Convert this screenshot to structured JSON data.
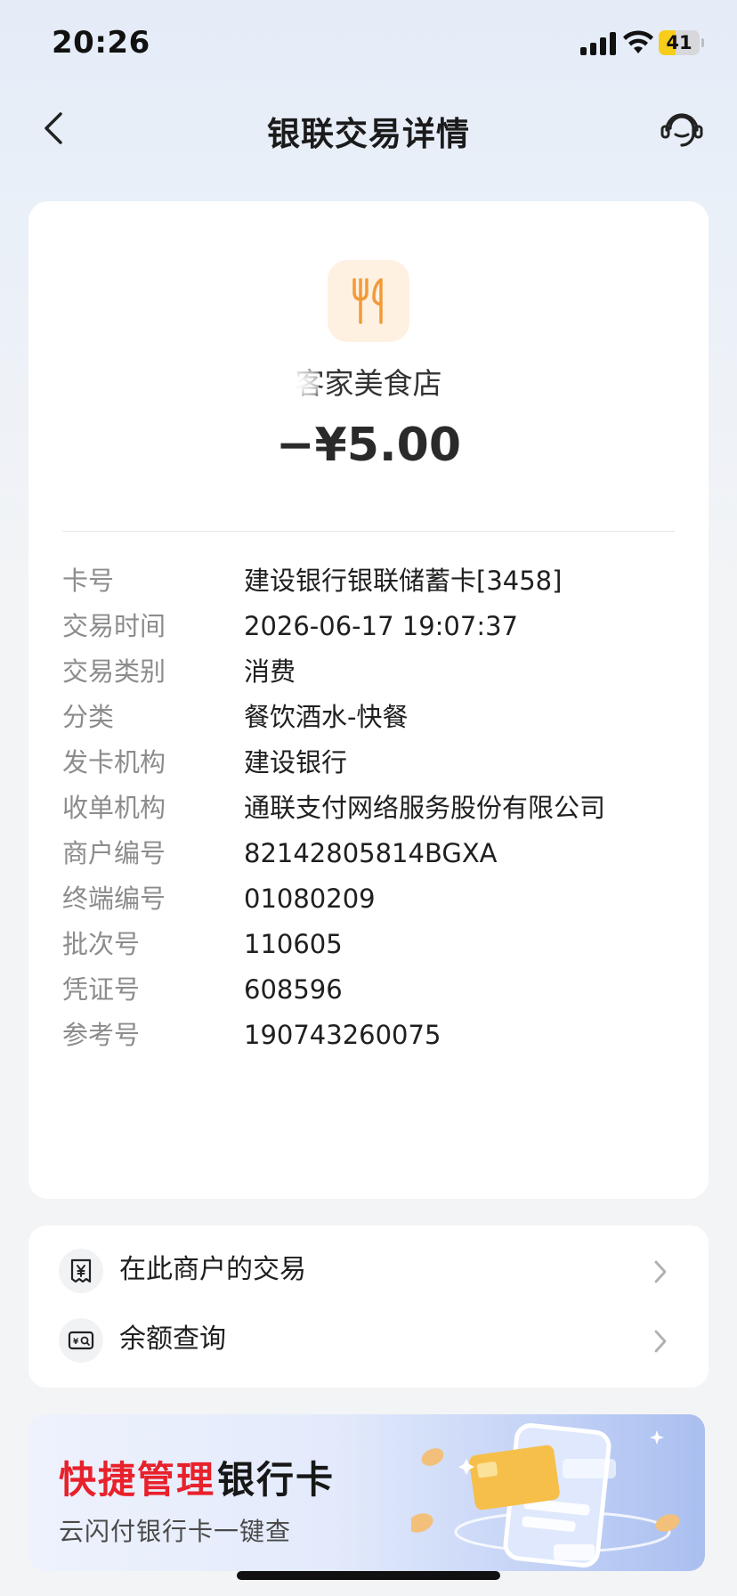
{
  "status_bar": {
    "time": "20:26",
    "battery": "41",
    "battery_level": 0.41
  },
  "nav": {
    "title": "银联交易详情",
    "back_icon": "chevron-left-icon",
    "service_icon": "headset-icon"
  },
  "transaction": {
    "merchant_icon": "fork-knife-icon",
    "merchant_name": "客家美食店",
    "amount": "−¥5.00",
    "details": [
      {
        "label": "卡号",
        "value": "建设银行银联储蓄卡[3458]"
      },
      {
        "label": "交易时间",
        "value": "2026-06-17 19:07:37"
      },
      {
        "label": "交易类别",
        "value": "消费"
      },
      {
        "label": "分类",
        "value": "餐饮酒水-快餐"
      },
      {
        "label": "发卡机构",
        "value": "建设银行"
      },
      {
        "label": "收单机构",
        "value": "通联支付网络服务股份有限公司"
      },
      {
        "label": "商户编号",
        "value": "82142805814BGXA"
      },
      {
        "label": "终端编号",
        "value": "01080209"
      },
      {
        "label": "批次号",
        "value": "110605"
      },
      {
        "label": "凭证号",
        "value": "608596"
      },
      {
        "label": "参考号",
        "value": "190743260075"
      }
    ]
  },
  "actions": [
    {
      "label": "在此商户的交易",
      "icon": "receipt-yuan-icon"
    },
    {
      "label": "余额查询",
      "icon": "balance-search-icon"
    }
  ],
  "banner": {
    "title_red": "快捷管理",
    "title_dark": "银行卡",
    "subtitle": "云闪付银行卡一键查"
  },
  "colors": {
    "accent_red": "#e8212b",
    "merchant_icon_orange": "#f29a38",
    "battery_yellow": "#f7cd1a"
  }
}
